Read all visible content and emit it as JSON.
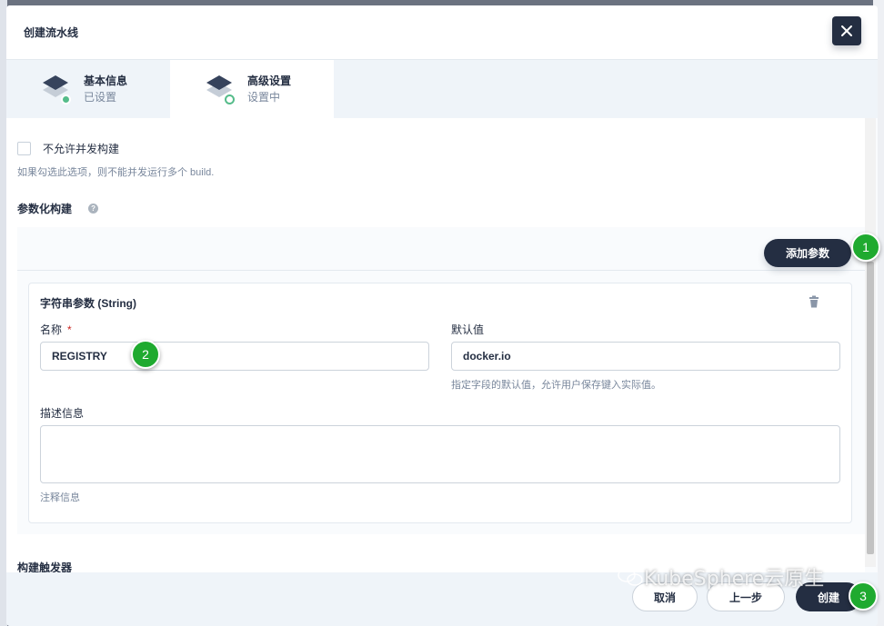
{
  "modal": {
    "title": "创建流水线"
  },
  "tabs": [
    {
      "label": "基本信息",
      "status": "已设置"
    },
    {
      "label": "高级设置",
      "status": "设置中"
    }
  ],
  "concurrency": {
    "label": "不允许并发构建",
    "hint": "如果勾选此选项，则不能并发运行多个 build."
  },
  "parameterized": {
    "title": "参数化构建",
    "help_glyph": "?",
    "add_button": "添加参数",
    "card": {
      "title": "字符串参数 (String)",
      "name_label": "名称",
      "required_mark": "*",
      "name_value": "REGISTRY",
      "default_label": "默认值",
      "default_value": "docker.io",
      "default_hint": "指定字段的默认值，允许用户保存键入实际值。",
      "desc_label": "描述信息",
      "desc_value": "",
      "desc_hint": "注释信息"
    }
  },
  "triggers": {
    "title": "构建触发器"
  },
  "footer": {
    "cancel": "取消",
    "prev": "上一步",
    "create": "创建"
  },
  "badges": [
    "1",
    "2",
    "3"
  ],
  "watermark": "KubeSphere云原生",
  "colors": {
    "primary": "#242e42",
    "success": "#55bc8a",
    "badge": "#1faa2f"
  }
}
